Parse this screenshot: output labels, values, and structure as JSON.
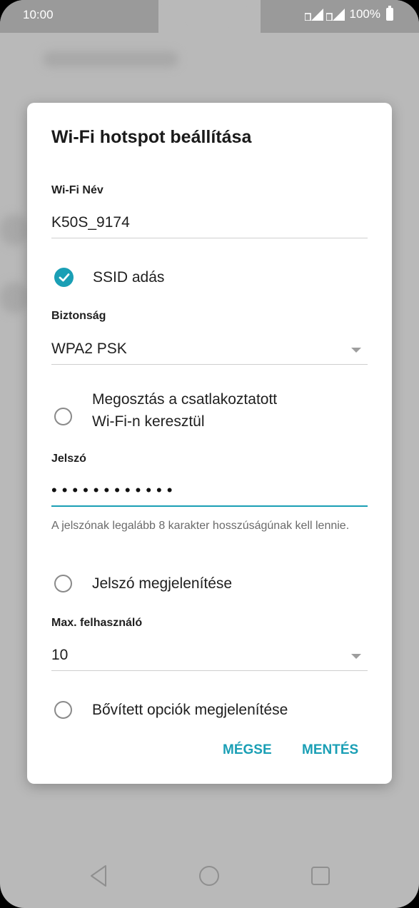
{
  "status": {
    "time": "10:00",
    "battery": "100%"
  },
  "dialog": {
    "title": "Wi-Fi hotspot beállítása",
    "name_label": "Wi-Fi Név",
    "name_value": "K50S_9174",
    "ssid_broadcast": {
      "label": "SSID adás",
      "checked": true
    },
    "security_label": "Biztonság",
    "security_value": "WPA2 PSK",
    "share_option": {
      "line1": "Megosztás a csatlakoztatott",
      "line2": "Wi-Fi-n keresztül",
      "checked": false
    },
    "password_label": "Jelszó",
    "password_mask": "••••••••••••",
    "password_helper": "A jelszónak legalább 8 karakter hosszúságúnak kell lennie.",
    "show_password": {
      "label": "Jelszó megjelenítése",
      "checked": false
    },
    "max_users_label": "Max. felhasználó",
    "max_users_value": "10",
    "advanced": {
      "label": "Bővített opciók megjelenítése",
      "checked": false
    },
    "cancel_label": "MÉGSE",
    "save_label": "MENTÉS"
  },
  "colors": {
    "accent": "#1a9fb5"
  },
  "navbar": {
    "icons": [
      "back-icon",
      "home-icon",
      "recents-icon"
    ]
  }
}
